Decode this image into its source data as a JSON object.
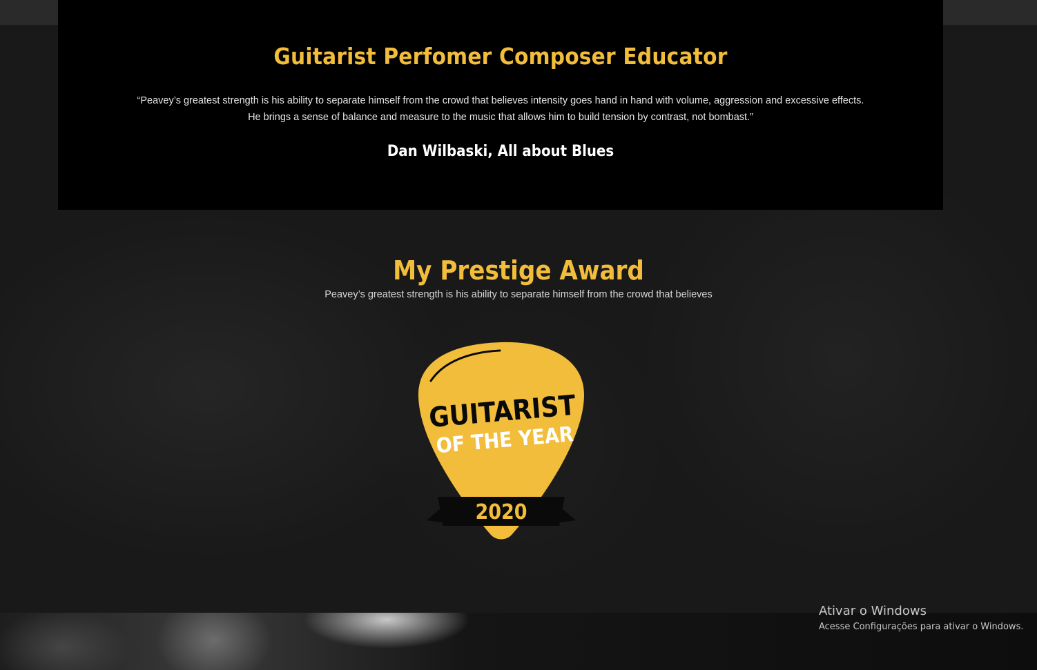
{
  "quote_section": {
    "title": "Guitarist Perfomer Composer Educator",
    "quote": "“Peavey’s greatest strength is his ability to separate himself from the crowd that believes intensity goes hand in hand with volume, aggression and excessive effects. He brings a sense of balance and measure to the music that allows him to build tension by contrast, not bombast.”",
    "author": "Dan Wilbaski, All about Blues"
  },
  "award_section": {
    "title": "My Prestige Award",
    "subtitle": "Peavey’s greatest strength is his ability to separate himself from the crowd that believes",
    "badge": {
      "line1": "GUITARIST",
      "line2": "OF THE YEAR",
      "year": "2020",
      "icon": "guitar-pick-icon"
    }
  },
  "windows_watermark": {
    "title": "Ativar o Windows",
    "subtitle": "Acesse Configurações para ativar o Windows."
  },
  "colors": {
    "accent": "#f2bd3b",
    "card_background": "#000000",
    "page_background": "#191919"
  }
}
